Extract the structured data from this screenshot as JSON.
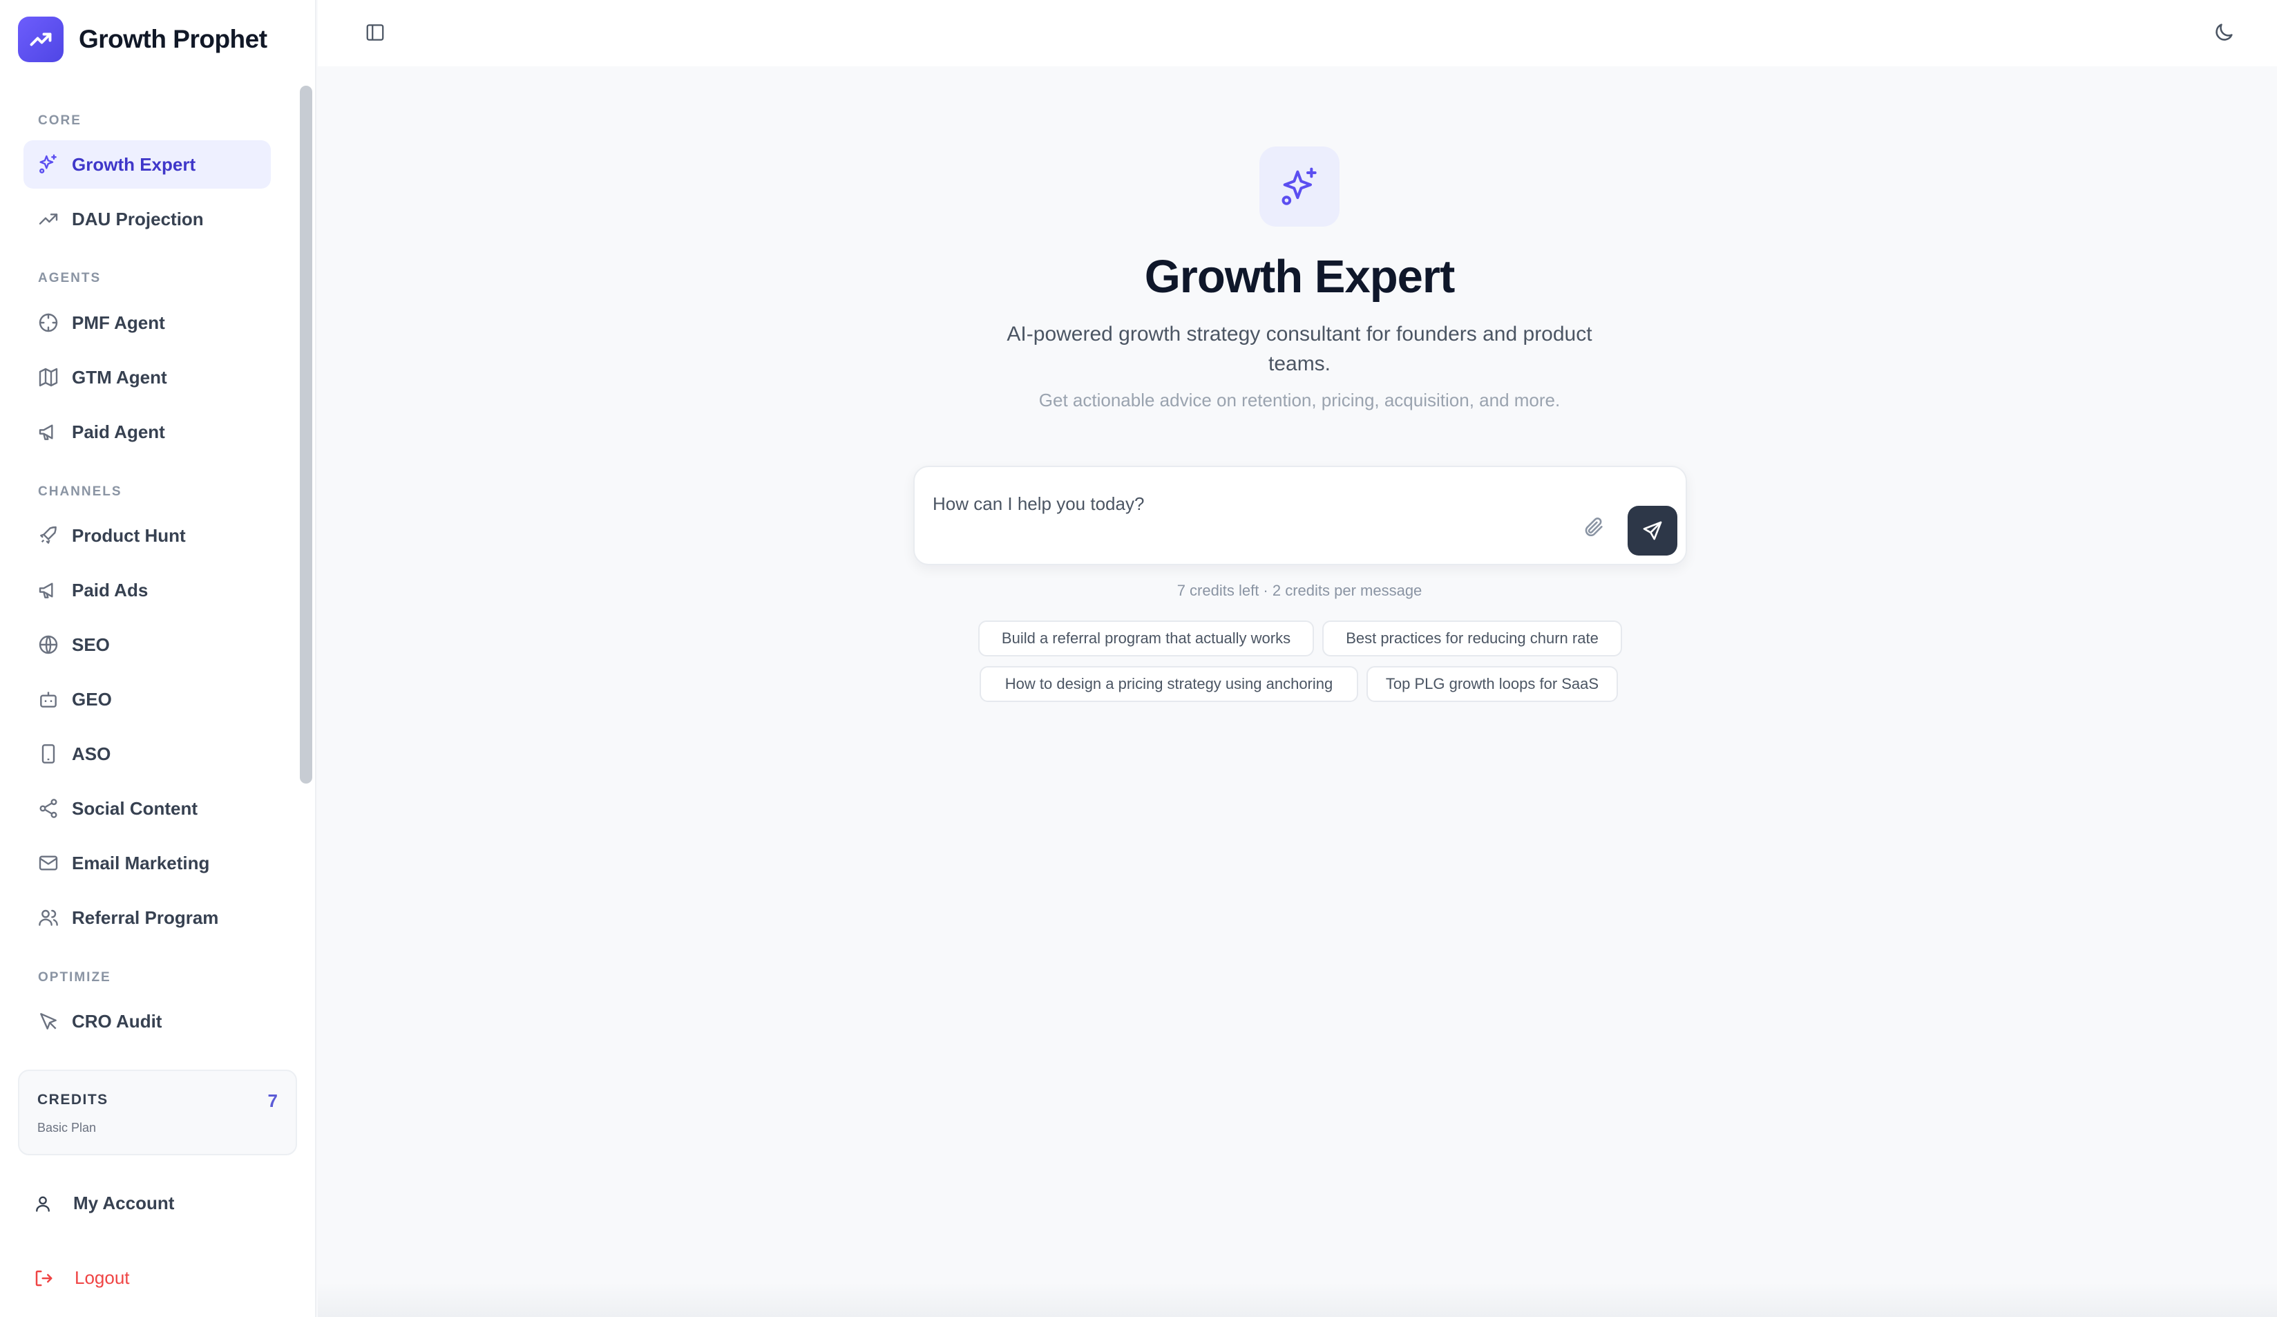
{
  "brand": {
    "name": "Growth Prophet",
    "icon": "trending-up-icon",
    "color": "#5b4ef0"
  },
  "sidebar": {
    "sections": [
      {
        "label": "CORE",
        "items": [
          {
            "label": "Growth Expert",
            "icon": "sparkles-icon",
            "active": true
          },
          {
            "label": "DAU Projection",
            "icon": "trending-up-icon"
          }
        ]
      },
      {
        "label": "AGENTS",
        "items": [
          {
            "label": "PMF Agent",
            "icon": "target-icon"
          },
          {
            "label": "GTM Agent",
            "icon": "map-icon"
          },
          {
            "label": "Paid Agent",
            "icon": "megaphone-icon"
          }
        ]
      },
      {
        "label": "CHANNELS",
        "items": [
          {
            "label": "Product Hunt",
            "icon": "rocket-icon"
          },
          {
            "label": "Paid Ads",
            "icon": "megaphone-icon"
          },
          {
            "label": "SEO",
            "icon": "globe-icon"
          },
          {
            "label": "GEO",
            "icon": "bot-icon"
          },
          {
            "label": "ASO",
            "icon": "smartphone-icon"
          },
          {
            "label": "Social Content",
            "icon": "share-icon"
          },
          {
            "label": "Email Marketing",
            "icon": "mail-icon"
          },
          {
            "label": "Referral Program",
            "icon": "users-icon"
          }
        ]
      },
      {
        "label": "OPTIMIZE",
        "items": [
          {
            "label": "CRO Audit",
            "icon": "cursor-icon"
          }
        ]
      }
    ],
    "credits": {
      "title": "CREDITS",
      "plan": "Basic Plan",
      "count": "7"
    },
    "account_label": "My Account",
    "logout_label": "Logout"
  },
  "topbar": {
    "sidebar_toggle_icon": "panel-left-icon",
    "theme_toggle_icon": "moon-icon"
  },
  "main": {
    "hero_icon": "sparkles-icon",
    "title": "Growth Expert",
    "subtitle": "AI-powered growth strategy consultant for founders and product teams.",
    "note": "Get actionable advice on retention, pricing, acquisition, and more.",
    "composer": {
      "placeholder": "How can I help you today?",
      "attach_icon": "paperclip-icon",
      "send_icon": "send-icon"
    },
    "credits_note": "7 credits left · 2 credits per message",
    "suggestions": [
      "Build a referral program that actually works",
      "Best practices for reducing churn rate",
      "How to design a pricing strategy using anchoring",
      "Top PLG growth loops for SaaS"
    ]
  },
  "colors": {
    "accent": "#4f46e5",
    "active_bg": "#eef0ff",
    "logout": "#ef4444",
    "send_button": "#2d3748"
  }
}
